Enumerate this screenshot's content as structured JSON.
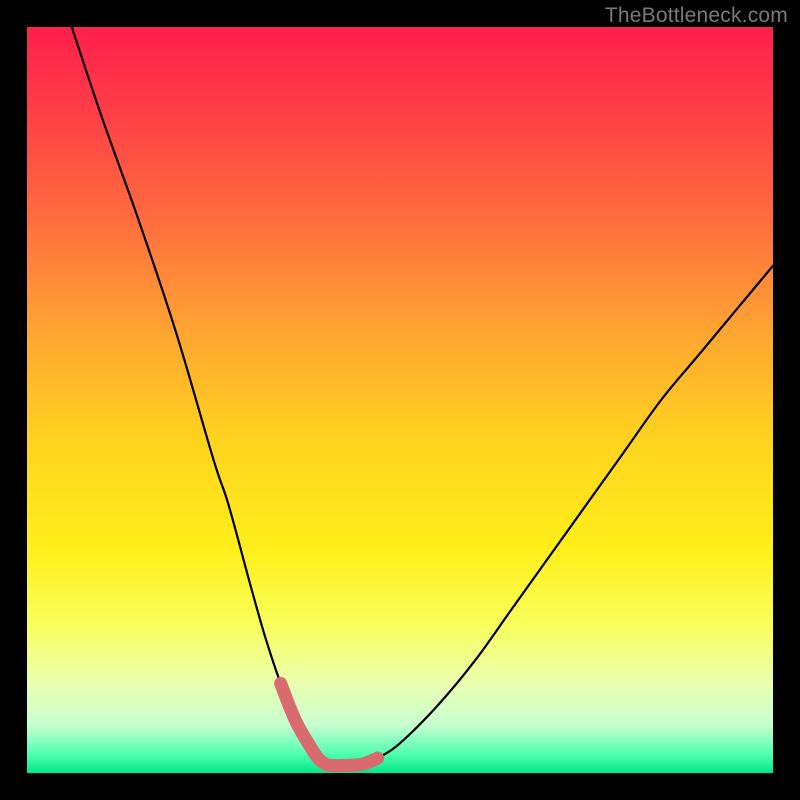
{
  "watermark": "TheBottleneck.com",
  "colors": {
    "background": "#000000",
    "watermark": "#7a7a7a",
    "curve": "#000000",
    "highlight": "#d96a6f",
    "gradient_stops": [
      {
        "offset": 0.0,
        "color": "#ff1f4b"
      },
      {
        "offset": 0.1,
        "color": "#ff3a48"
      },
      {
        "offset": 0.25,
        "color": "#ff6a3e"
      },
      {
        "offset": 0.4,
        "color": "#ffa233"
      },
      {
        "offset": 0.55,
        "color": "#ffd21f"
      },
      {
        "offset": 0.7,
        "color": "#ffef1a"
      },
      {
        "offset": 0.8,
        "color": "#f8ff5a"
      },
      {
        "offset": 0.88,
        "color": "#eaffb0"
      },
      {
        "offset": 0.935,
        "color": "#c8ffd0"
      },
      {
        "offset": 0.975,
        "color": "#4fffb0"
      },
      {
        "offset": 1.0,
        "color": "#00e88a"
      }
    ]
  },
  "chart_data": {
    "type": "line",
    "title": "",
    "xlabel": "",
    "ylabel": "",
    "xlim": [
      0,
      100
    ],
    "ylim": [
      0,
      100
    ],
    "grid": false,
    "legend": false,
    "series": [
      {
        "name": "bottleneck-curve",
        "x": [
          6,
          10,
          15,
          20,
          25,
          27,
          30,
          32,
          34,
          36,
          38,
          39,
          40,
          41,
          42.5,
          45,
          47,
          50,
          55,
          60,
          65,
          70,
          75,
          80,
          85,
          90,
          95,
          100
        ],
        "y": [
          100,
          88,
          74,
          59,
          42,
          36,
          25,
          18,
          12,
          7,
          3.5,
          2,
          1.2,
          1.0,
          1.0,
          1.2,
          2,
          4,
          9,
          15,
          22,
          29,
          36,
          43,
          50,
          56,
          62,
          68
        ]
      }
    ],
    "annotations": [
      {
        "name": "valley-highlight",
        "type": "segment-overlay",
        "x_range": [
          34,
          47
        ],
        "style": "thick-salmon"
      }
    ]
  }
}
